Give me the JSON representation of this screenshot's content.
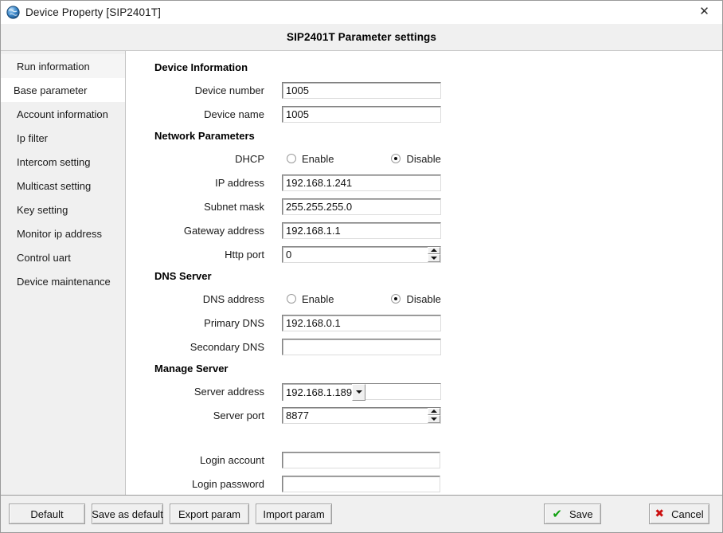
{
  "window": {
    "title": "Device Property [SIP2401T]",
    "icon": "globe-icon",
    "close_label": "✕"
  },
  "header": {
    "title": "SIP2401T Parameter settings"
  },
  "sidebar": {
    "items": [
      {
        "label": "Run information",
        "selected": false
      },
      {
        "label": "Base parameter",
        "selected": true
      },
      {
        "label": "Account information",
        "selected": false
      },
      {
        "label": "Ip filter",
        "selected": false
      },
      {
        "label": "Intercom setting",
        "selected": false
      },
      {
        "label": "Multicast setting",
        "selected": false
      },
      {
        "label": "Key setting",
        "selected": false
      },
      {
        "label": "Monitor ip address",
        "selected": false
      },
      {
        "label": "Control uart",
        "selected": false
      },
      {
        "label": "Device maintenance",
        "selected": false
      }
    ]
  },
  "sections": {
    "device_information": {
      "title": "Device Information",
      "device_number": {
        "label": "Device number",
        "value": "1005"
      },
      "device_name": {
        "label": "Device name",
        "value": "1005"
      }
    },
    "network_parameters": {
      "title": "Network Parameters",
      "dhcp": {
        "label": "DHCP",
        "enable_label": "Enable",
        "disable_label": "Disable",
        "selected": "Disable"
      },
      "ip_address": {
        "label": "IP address",
        "value": "192.168.1.241"
      },
      "subnet_mask": {
        "label": "Subnet mask",
        "value": "255.255.255.0"
      },
      "gateway_address": {
        "label": "Gateway address",
        "value": "192.168.1.1"
      },
      "http_port": {
        "label": "Http port",
        "value": "0"
      }
    },
    "dns_server": {
      "title": "DNS Server",
      "dns_address": {
        "label": "DNS address",
        "enable_label": "Enable",
        "disable_label": "Disable",
        "selected": "Disable"
      },
      "primary_dns": {
        "label": "Primary DNS",
        "value": "192.168.0.1"
      },
      "secondary_dns": {
        "label": "Secondary DNS",
        "value": ""
      }
    },
    "manage_server": {
      "title": "Manage Server",
      "server_address": {
        "label": "Server address",
        "value": "192.168.1.189"
      },
      "server_port": {
        "label": "Server port",
        "value": "8877"
      },
      "login_account": {
        "label": "Login account",
        "value": ""
      },
      "login_password": {
        "label": "Login password",
        "value": ""
      }
    }
  },
  "footer": {
    "default_label": "Default",
    "save_as_default_label": "Save as default",
    "export_param_label": "Export param",
    "import_param_label": "Import param",
    "save_label": "Save",
    "cancel_label": "Cancel",
    "save_icon": "check-icon",
    "cancel_icon": "x-icon",
    "save_icon_glyph": "✔",
    "cancel_icon_glyph": "✖"
  },
  "colors": {
    "accent_save": "#10a010",
    "accent_cancel": "#cc1111",
    "chrome": "#f0f0f0",
    "content": "#ffffff"
  }
}
